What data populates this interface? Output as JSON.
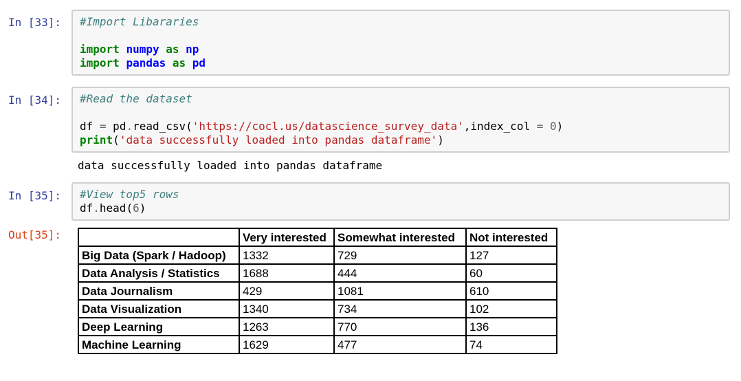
{
  "cells": [
    {
      "prompt": "In [33]:",
      "lines": [
        [
          {
            "t": "#Import Libararies",
            "c": "comment"
          }
        ],
        [],
        [
          {
            "t": "import",
            "c": "kw"
          },
          {
            "t": " "
          },
          {
            "t": "numpy",
            "c": "mod"
          },
          {
            "t": " "
          },
          {
            "t": "as",
            "c": "kw"
          },
          {
            "t": " "
          },
          {
            "t": "np",
            "c": "mod"
          }
        ],
        [
          {
            "t": "import",
            "c": "kw"
          },
          {
            "t": " "
          },
          {
            "t": "pandas",
            "c": "mod"
          },
          {
            "t": " "
          },
          {
            "t": "as",
            "c": "kw"
          },
          {
            "t": " "
          },
          {
            "t": "pd",
            "c": "mod"
          }
        ]
      ]
    },
    {
      "prompt": "In [34]:",
      "lines": [
        [
          {
            "t": "#Read the dataset",
            "c": "comment"
          }
        ],
        [],
        [
          {
            "t": "df "
          },
          {
            "t": "=",
            "c": "op"
          },
          {
            "t": " pd"
          },
          {
            "t": ".",
            "c": "op"
          },
          {
            "t": "read_csv("
          },
          {
            "t": "'https://cocl.us/datascience_survey_data'",
            "c": "str"
          },
          {
            "t": ",index_col "
          },
          {
            "t": "=",
            "c": "op"
          },
          {
            "t": " "
          },
          {
            "t": "0",
            "c": "num"
          },
          {
            "t": ")"
          }
        ],
        [
          {
            "t": "print",
            "c": "kw-plain"
          },
          {
            "t": "("
          },
          {
            "t": "'data successfully loaded into pandas dataframe'",
            "c": "str"
          },
          {
            "t": ")"
          }
        ]
      ],
      "stdout": "data successfully loaded into pandas dataframe"
    },
    {
      "prompt": "In [35]:",
      "lines": [
        [
          {
            "t": "#View top5 rows",
            "c": "comment"
          }
        ],
        [
          {
            "t": "df"
          },
          {
            "t": ".",
            "c": "op"
          },
          {
            "t": "head("
          },
          {
            "t": "6",
            "c": "num"
          },
          {
            "t": ")"
          }
        ]
      ]
    }
  ],
  "output": {
    "prompt": "Out[35]:",
    "table": {
      "index_header": "",
      "columns": [
        "Very interested",
        "Somewhat interested",
        "Not interested"
      ],
      "rows": [
        {
          "index": "Big Data (Spark / Hadoop)",
          "values": [
            "1332",
            "729",
            "127"
          ]
        },
        {
          "index": "Data Analysis / Statistics",
          "values": [
            "1688",
            "444",
            "60"
          ]
        },
        {
          "index": "Data Journalism",
          "values": [
            "429",
            "1081",
            "610"
          ]
        },
        {
          "index": "Data Visualization",
          "values": [
            "1340",
            "734",
            "102"
          ]
        },
        {
          "index": "Deep Learning",
          "values": [
            "1263",
            "770",
            "136"
          ]
        },
        {
          "index": "Machine Learning",
          "values": [
            "1629",
            "477",
            "74"
          ]
        }
      ]
    }
  },
  "colors": {
    "prompt_in": "#303f9f",
    "prompt_out": "#d84315",
    "comment": "#408080",
    "keyword": "#008000",
    "module": "#0000ff",
    "string": "#ba2121",
    "number": "#666666",
    "cell_bg": "#f7f7f7",
    "cell_border": "#cfcfcf"
  }
}
